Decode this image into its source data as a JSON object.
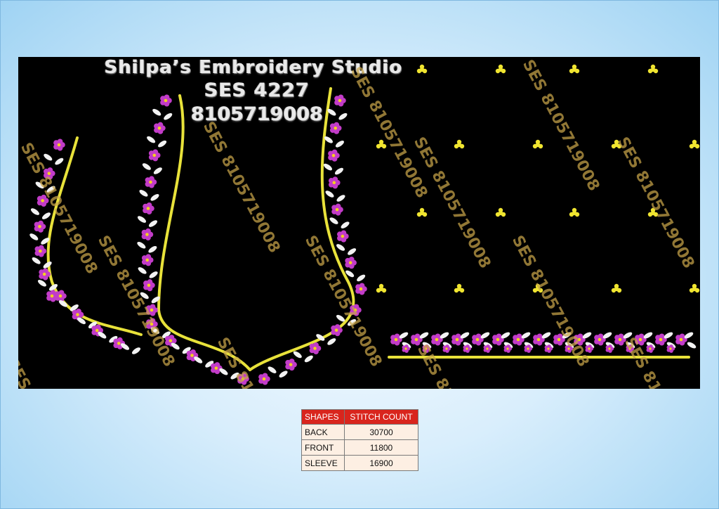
{
  "studio": {
    "name": "Shilpa’s Embroidery Studio",
    "design_code": "SES 4227",
    "phone": "8105719008"
  },
  "watermark_text": "SES 8105719008",
  "colors": {
    "background": "#000000",
    "flower": "#c23cc8",
    "leaf": "#f2f2f2",
    "outline": "#e8e23a",
    "dot": "#f0e530",
    "watermark": "#c9a64a",
    "table_header": "#d9251d",
    "table_cell": "#fdefe3"
  },
  "stitch_table": {
    "headers": [
      "SHAPES",
      "STITCH COUNT"
    ],
    "rows": [
      {
        "shape": "BACK",
        "count": "30700"
      },
      {
        "shape": "FRONT",
        "count": "11800"
      },
      {
        "shape": "SLEEVE",
        "count": "16900"
      }
    ]
  }
}
